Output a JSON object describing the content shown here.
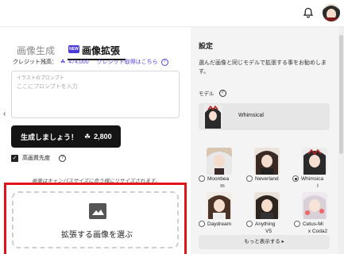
{
  "header": {
    "bell_icon": "bell-icon",
    "avatar_icon": "user-avatar"
  },
  "tabs": {
    "generate": "画像生成",
    "new_badge": "NEW",
    "upscale": "画像拡張"
  },
  "credits": {
    "label": "クレジット残高：",
    "icon": "clover-icon",
    "value": "474,000",
    "link": "クレジット取得はこちら",
    "help": "?"
  },
  "prompt": {
    "label": "イラストのプロンプト",
    "placeholder": "ここにプロンプトを入力"
  },
  "generate_button": {
    "label": "生成しましょう！",
    "cost": "2,800"
  },
  "priority": {
    "label": "高画質先度",
    "checked": true,
    "help": "?"
  },
  "resize_note": "画像はキャンバスサイズに合う様にリサイズされます。",
  "upload": {
    "label": "拡張する画像を選ぶ",
    "icon": "image-icon"
  },
  "settings": {
    "title": "設定",
    "description": "選んだ画像と同じモデルで拡張する事をお勧めします。",
    "model_label": "モデル",
    "help": "?",
    "selected_model": "Whimsical",
    "models": [
      {
        "name1": "Moonbea",
        "name2": "m",
        "checked": false
      },
      {
        "name1": "Neverland",
        "name2": "",
        "checked": false
      },
      {
        "name1": "Whimsica",
        "name2": "l",
        "checked": true
      },
      {
        "name1": "Daydream",
        "name2": "",
        "checked": false
      },
      {
        "name1": "Anything",
        "name2": "V5",
        "checked": false
      },
      {
        "name1": "Cetus-Mi",
        "name2": "x Coda2",
        "checked": false
      }
    ],
    "more_button": "もっと表示する ▸"
  },
  "colors": {
    "accent": "#5a3fd6",
    "highlight": "#e0141a",
    "button_dark": "#141414"
  }
}
